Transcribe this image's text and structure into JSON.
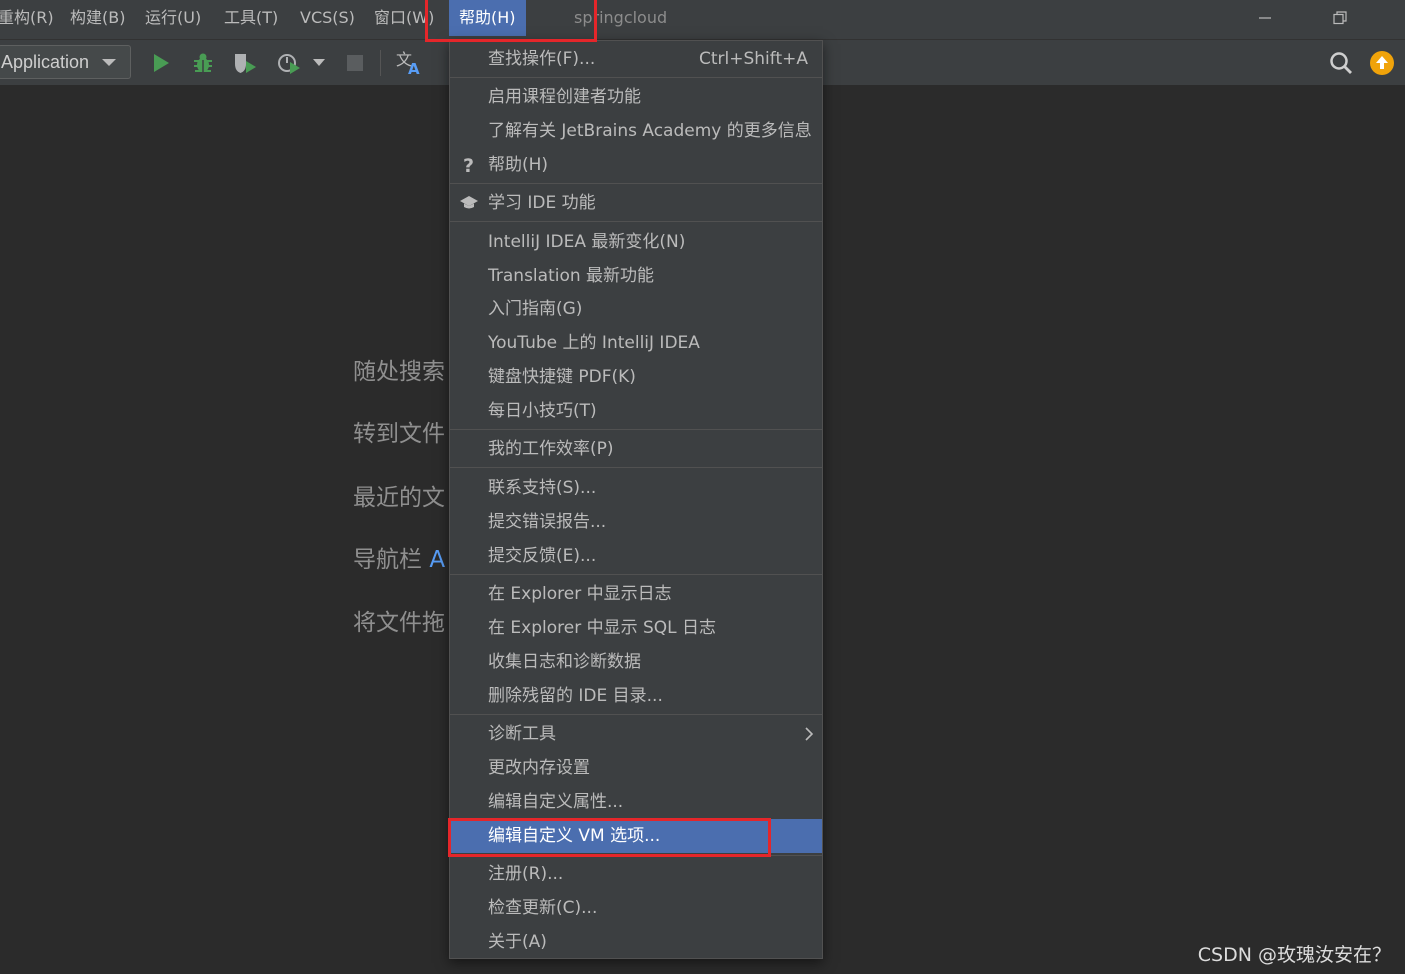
{
  "menubar": {
    "items": [
      "重构(R)",
      "构建(B)",
      "运行(U)",
      "工具(T)",
      "VCS(S)",
      "窗口(W)"
    ],
    "active_item": "帮助(H)",
    "project_title": "springcloud"
  },
  "toolbar": {
    "run_config": "Application",
    "icons": [
      "run-icon",
      "debug-icon",
      "coverage-icon",
      "profile-icon",
      "dropdown-icon",
      "stop-icon",
      "translate-icon"
    ],
    "right_icons": [
      "search-icon",
      "update-icon"
    ],
    "colors": {
      "run": "#499c54",
      "update": "#f0a30a"
    }
  },
  "editor": {
    "hints": [
      "随处搜索",
      "转到文件",
      "最近的文",
      "导航栏",
      "将文件拖"
    ],
    "hint_accent": "A"
  },
  "help_menu": {
    "find_action": {
      "label": "查找操作(F)...",
      "shortcut": "Ctrl+Shift+A"
    },
    "items": {
      "course_creator": "启用课程创建者功能",
      "jetbrains_academy": "了解有关 JetBrains Academy 的更多信息",
      "help": "帮助(H)",
      "learn_ide": "学习 IDE 功能",
      "whats_new": "IntelliJ IDEA 最新变化(N)",
      "translation_new": "Translation 最新功能",
      "getting_started": "入门指南(G)",
      "youtube": "YouTube 上的 IntelliJ IDEA",
      "keymap_pdf": "键盘快捷键 PDF(K)",
      "tip_of_day": "每日小技巧(T)",
      "productivity": "我的工作效率(P)",
      "contact_support": "联系支持(S)...",
      "submit_bug": "提交错误报告...",
      "submit_feedback": "提交反馈(E)...",
      "show_log": "在 Explorer 中显示日志",
      "show_sql_log": "在 Explorer 中显示 SQL 日志",
      "collect_logs": "收集日志和诊断数据",
      "delete_leftover": "删除残留的 IDE 目录...",
      "diagnostic_tools": "诊断工具",
      "change_memory": "更改内存设置",
      "edit_properties": "编辑自定义属性...",
      "edit_vm_options": "编辑自定义 VM 选项...",
      "register": "注册(R)...",
      "check_updates": "检查更新(C)...",
      "about": "关于(A)"
    }
  },
  "watermark": "CSDN @玫瑰汝安在？",
  "highlight_color": "#e5262a"
}
